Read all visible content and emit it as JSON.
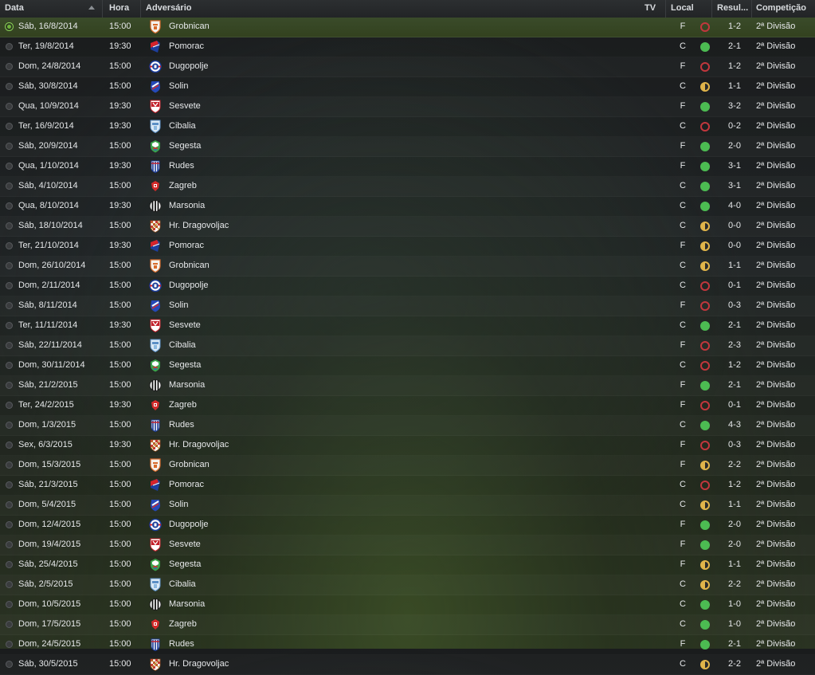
{
  "header": {
    "date": "Data",
    "time": "Hora",
    "opponent": "Adversário",
    "tv": "TV",
    "venue": "Local",
    "result": "Resul...",
    "competition": "Competição"
  },
  "colors": {
    "win": "#4cbb52",
    "draw": "#e0b44a",
    "loss": "#c2373d",
    "selected_row": "#3a4b2a"
  },
  "matches": [
    {
      "date": "Sáb, 16/8/2014",
      "time": "15:00",
      "opponent": "Grobnican",
      "crest": "grobnican-crest-icon",
      "venue": "F",
      "result": "loss",
      "score": "1-2",
      "competition": "2ª Divisão",
      "selected": true
    },
    {
      "date": "Ter, 19/8/2014",
      "time": "19:30",
      "opponent": "Pomorac",
      "crest": "pomorac-crest-icon",
      "venue": "C",
      "result": "win",
      "score": "2-1",
      "competition": "2ª Divisão"
    },
    {
      "date": "Dom, 24/8/2014",
      "time": "15:00",
      "opponent": "Dugopolje",
      "crest": "dugopolje-crest-icon",
      "venue": "F",
      "result": "loss",
      "score": "1-2",
      "competition": "2ª Divisão"
    },
    {
      "date": "Sáb, 30/8/2014",
      "time": "15:00",
      "opponent": "Solin",
      "crest": "solin-crest-icon",
      "venue": "C",
      "result": "draw",
      "score": "1-1",
      "competition": "2ª Divisão"
    },
    {
      "date": "Qua, 10/9/2014",
      "time": "19:30",
      "opponent": "Sesvete",
      "crest": "sesvete-crest-icon",
      "venue": "F",
      "result": "win",
      "score": "3-2",
      "competition": "2ª Divisão"
    },
    {
      "date": "Ter, 16/9/2014",
      "time": "19:30",
      "opponent": "Cibalia",
      "crest": "cibalia-crest-icon",
      "venue": "C",
      "result": "loss",
      "score": "0-2",
      "competition": "2ª Divisão"
    },
    {
      "date": "Sáb, 20/9/2014",
      "time": "15:00",
      "opponent": "Segesta",
      "crest": "segesta-crest-icon",
      "venue": "F",
      "result": "win",
      "score": "2-0",
      "competition": "2ª Divisão"
    },
    {
      "date": "Qua, 1/10/2014",
      "time": "19:30",
      "opponent": "Rudes",
      "crest": "rudes-crest-icon",
      "venue": "F",
      "result": "win",
      "score": "3-1",
      "competition": "2ª Divisão"
    },
    {
      "date": "Sáb, 4/10/2014",
      "time": "15:00",
      "opponent": "Zagreb",
      "crest": "zagreb-crest-icon",
      "venue": "C",
      "result": "win",
      "score": "3-1",
      "competition": "2ª Divisão"
    },
    {
      "date": "Qua, 8/10/2014",
      "time": "19:30",
      "opponent": "Marsonia",
      "crest": "marsonia-crest-icon",
      "venue": "C",
      "result": "win",
      "score": "4-0",
      "competition": "2ª Divisão"
    },
    {
      "date": "Sáb, 18/10/2014",
      "time": "15:00",
      "opponent": "Hr. Dragovoljac",
      "crest": "dragovoljac-crest-icon",
      "venue": "C",
      "result": "draw",
      "score": "0-0",
      "competition": "2ª Divisão"
    },
    {
      "date": "Ter, 21/10/2014",
      "time": "19:30",
      "opponent": "Pomorac",
      "crest": "pomorac-crest-icon",
      "venue": "F",
      "result": "draw",
      "score": "0-0",
      "competition": "2ª Divisão"
    },
    {
      "date": "Dom, 26/10/2014",
      "time": "15:00",
      "opponent": "Grobnican",
      "crest": "grobnican-crest-icon",
      "venue": "C",
      "result": "draw",
      "score": "1-1",
      "competition": "2ª Divisão"
    },
    {
      "date": "Dom, 2/11/2014",
      "time": "15:00",
      "opponent": "Dugopolje",
      "crest": "dugopolje-crest-icon",
      "venue": "C",
      "result": "loss",
      "score": "0-1",
      "competition": "2ª Divisão"
    },
    {
      "date": "Sáb, 8/11/2014",
      "time": "15:00",
      "opponent": "Solin",
      "crest": "solin-crest-icon",
      "venue": "F",
      "result": "loss",
      "score": "0-3",
      "competition": "2ª Divisão"
    },
    {
      "date": "Ter, 11/11/2014",
      "time": "19:30",
      "opponent": "Sesvete",
      "crest": "sesvete-crest-icon",
      "venue": "C",
      "result": "win",
      "score": "2-1",
      "competition": "2ª Divisão"
    },
    {
      "date": "Sáb, 22/11/2014",
      "time": "15:00",
      "opponent": "Cibalia",
      "crest": "cibalia-crest-icon",
      "venue": "F",
      "result": "loss",
      "score": "2-3",
      "competition": "2ª Divisão"
    },
    {
      "date": "Dom, 30/11/2014",
      "time": "15:00",
      "opponent": "Segesta",
      "crest": "segesta-crest-icon",
      "venue": "C",
      "result": "loss",
      "score": "1-2",
      "competition": "2ª Divisão"
    },
    {
      "date": "Sáb, 21/2/2015",
      "time": "15:00",
      "opponent": "Marsonia",
      "crest": "marsonia-crest-icon",
      "venue": "F",
      "result": "win",
      "score": "2-1",
      "competition": "2ª Divisão"
    },
    {
      "date": "Ter, 24/2/2015",
      "time": "19:30",
      "opponent": "Zagreb",
      "crest": "zagreb-crest-icon",
      "venue": "F",
      "result": "loss",
      "score": "0-1",
      "competition": "2ª Divisão"
    },
    {
      "date": "Dom, 1/3/2015",
      "time": "15:00",
      "opponent": "Rudes",
      "crest": "rudes-crest-icon",
      "venue": "C",
      "result": "win",
      "score": "4-3",
      "competition": "2ª Divisão"
    },
    {
      "date": "Sex, 6/3/2015",
      "time": "19:30",
      "opponent": "Hr. Dragovoljac",
      "crest": "dragovoljac-crest-icon",
      "venue": "F",
      "result": "loss",
      "score": "0-3",
      "competition": "2ª Divisão"
    },
    {
      "date": "Dom, 15/3/2015",
      "time": "15:00",
      "opponent": "Grobnican",
      "crest": "grobnican-crest-icon",
      "venue": "F",
      "result": "draw",
      "score": "2-2",
      "competition": "2ª Divisão"
    },
    {
      "date": "Sáb, 21/3/2015",
      "time": "15:00",
      "opponent": "Pomorac",
      "crest": "pomorac-crest-icon",
      "venue": "C",
      "result": "loss",
      "score": "1-2",
      "competition": "2ª Divisão"
    },
    {
      "date": "Dom, 5/4/2015",
      "time": "15:00",
      "opponent": "Solin",
      "crest": "solin-crest-icon",
      "venue": "C",
      "result": "draw",
      "score": "1-1",
      "competition": "2ª Divisão"
    },
    {
      "date": "Dom, 12/4/2015",
      "time": "15:00",
      "opponent": "Dugopolje",
      "crest": "dugopolje-crest-icon",
      "venue": "F",
      "result": "win",
      "score": "2-0",
      "competition": "2ª Divisão"
    },
    {
      "date": "Dom, 19/4/2015",
      "time": "15:00",
      "opponent": "Sesvete",
      "crest": "sesvete-crest-icon",
      "venue": "F",
      "result": "win",
      "score": "2-0",
      "competition": "2ª Divisão"
    },
    {
      "date": "Sáb, 25/4/2015",
      "time": "15:00",
      "opponent": "Segesta",
      "crest": "segesta-crest-icon",
      "venue": "F",
      "result": "draw",
      "score": "1-1",
      "competition": "2ª Divisão"
    },
    {
      "date": "Sáb, 2/5/2015",
      "time": "15:00",
      "opponent": "Cibalia",
      "crest": "cibalia-crest-icon",
      "venue": "C",
      "result": "draw",
      "score": "2-2",
      "competition": "2ª Divisão"
    },
    {
      "date": "Dom, 10/5/2015",
      "time": "15:00",
      "opponent": "Marsonia",
      "crest": "marsonia-crest-icon",
      "venue": "C",
      "result": "win",
      "score": "1-0",
      "competition": "2ª Divisão"
    },
    {
      "date": "Dom, 17/5/2015",
      "time": "15:00",
      "opponent": "Zagreb",
      "crest": "zagreb-crest-icon",
      "venue": "C",
      "result": "win",
      "score": "1-0",
      "competition": "2ª Divisão"
    },
    {
      "date": "Dom, 24/5/2015",
      "time": "15:00",
      "opponent": "Rudes",
      "crest": "rudes-crest-icon",
      "venue": "F",
      "result": "win",
      "score": "2-1",
      "competition": "2ª Divisão"
    },
    {
      "date": "Sáb, 30/5/2015",
      "time": "15:00",
      "opponent": "Hr. Dragovoljac",
      "crest": "dragovoljac-crest-icon",
      "venue": "C",
      "result": "draw",
      "score": "2-2",
      "competition": "2ª Divisão"
    }
  ]
}
